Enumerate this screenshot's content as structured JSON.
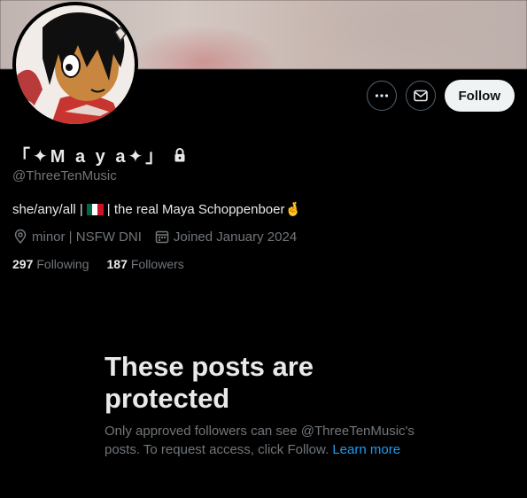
{
  "profile": {
    "display_name": "「✦M a y a✦」",
    "handle": "@ThreeTenMusic",
    "bio_before_flag": "she/any/all | ",
    "bio_after_flag": " | the real Maya Schoppenboer ",
    "bio_emoji": "🤞",
    "location": "minor | NSFW DNI",
    "joined": "Joined January 2024",
    "following_count": "297",
    "following_label": "Following",
    "followers_count": "187",
    "followers_label": "Followers"
  },
  "actions": {
    "more_icon": "more-icon",
    "message_icon": "envelope-icon",
    "follow_label": "Follow"
  },
  "protected_notice": {
    "title": "These posts are protected",
    "body": "Only approved followers can see @ThreeTenMusic's posts. To request access, click Follow.",
    "link": "Learn more"
  },
  "colors": {
    "background": "#000000",
    "text_primary": "#e7e9ea",
    "text_secondary": "#71767b",
    "link": "#1d9bf0",
    "follow_button_bg": "#eff3f4"
  }
}
